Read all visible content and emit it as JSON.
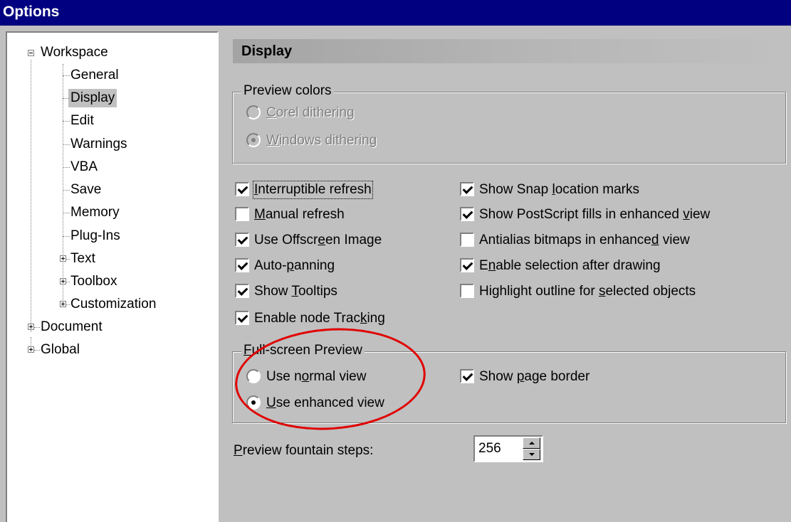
{
  "window": {
    "title": "Options"
  },
  "tree": {
    "workspace": "Workspace",
    "general": "General",
    "display": "Display",
    "edit": "Edit",
    "warnings": "Warnings",
    "vba": "VBA",
    "save": "Save",
    "memory": "Memory",
    "plugins": "Plug-Ins",
    "text": "Text",
    "toolbox": "Toolbox",
    "customization": "Customization",
    "document": "Document",
    "global": "Global"
  },
  "panel": {
    "title": "Display"
  },
  "preview_colors": {
    "legend": "Preview colors",
    "corel_a": "C",
    "corel_b": "orel dithering",
    "windows_a": "W",
    "windows_b": "indows dithering"
  },
  "options": {
    "interruptible": {
      "a": "I",
      "b": "nterruptible refresh",
      "checked": true
    },
    "manual": {
      "a": "M",
      "b": "anual refresh",
      "checked": false
    },
    "offscreen": {
      "a": "Use Offscr",
      "u": "e",
      "b": "en Image",
      "checked": true
    },
    "autopan": {
      "a": "Auto-",
      "u": "p",
      "b": "anning",
      "checked": true
    },
    "tooltips": {
      "a": "Show ",
      "u": "T",
      "b": "ooltips",
      "checked": true
    },
    "node": {
      "a": "Enable node Trac",
      "u": "k",
      "b": "ing",
      "checked": true
    },
    "snap": {
      "a": "Show Snap ",
      "u": "l",
      "b": "ocation marks",
      "checked": true
    },
    "postscript": {
      "a": "Show PostScript fills in enhanced ",
      "u": "v",
      "b": "iew",
      "checked": true
    },
    "antialias": {
      "a": "Antialias bitmaps in enhance",
      "u": "d",
      "b": " view",
      "checked": false
    },
    "selection": {
      "a": "E",
      "u": "n",
      "b": "able selection after drawing",
      "checked": true
    },
    "highlight": {
      "a": "Highlight outline for ",
      "u": "s",
      "b": "elected objects",
      "checked": false
    }
  },
  "fullscreen": {
    "legend_a": "F",
    "legend_b": "ull-screen Preview",
    "normal": {
      "a": "Use n",
      "u": "o",
      "b": "rmal view"
    },
    "enhanced": {
      "u": "U",
      "b": "se enhanced view"
    },
    "page_border": {
      "a": "Show ",
      "u": "p",
      "b": "age border",
      "checked": true
    }
  },
  "fountain": {
    "label_u": "P",
    "label_b": "review fountain steps:",
    "value": "256"
  },
  "colors": {
    "titlebar": "#000080",
    "annotation": "#e00000"
  }
}
